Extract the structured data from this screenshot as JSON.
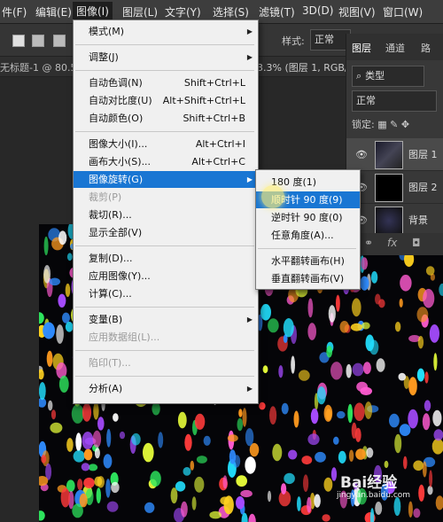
{
  "menubar": {
    "items": [
      "件(F)",
      "编辑(E)",
      "图像(I)",
      "图层(L)",
      "文字(Y)",
      "选择(S)",
      "滤镜(T)",
      "3D(D)",
      "视图(V)",
      "窗口(W)"
    ]
  },
  "options": {
    "style_label": "样式:",
    "style_value": "正常"
  },
  "document_tab": {
    "left": "无标题-1 @ 80.5",
    "right": "3.3% (图层 1, RGB/8"
  },
  "layers_panel": {
    "tabs": [
      "图层",
      "通道",
      "路"
    ],
    "kind_filter": "类型",
    "blend_mode": "正常",
    "lock_label": "锁定:",
    "layers": [
      {
        "name": "图层 1"
      },
      {
        "name": "图层 2"
      },
      {
        "name": "背景"
      }
    ],
    "footer": "fx"
  },
  "image_menu": {
    "items": [
      {
        "label": "模式(M)",
        "shortcut": "",
        "submenu": true
      },
      {
        "sep": true
      },
      {
        "label": "调整(J)",
        "shortcut": "",
        "submenu": true
      },
      {
        "sep": true
      },
      {
        "label": "自动色调(N)",
        "shortcut": "Shift+Ctrl+L"
      },
      {
        "label": "自动对比度(U)",
        "shortcut": "Alt+Shift+Ctrl+L"
      },
      {
        "label": "自动颜色(O)",
        "shortcut": "Shift+Ctrl+B"
      },
      {
        "sep": true
      },
      {
        "label": "图像大小(I)...",
        "shortcut": "Alt+Ctrl+I"
      },
      {
        "label": "画布大小(S)...",
        "shortcut": "Alt+Ctrl+C"
      },
      {
        "label": "图像旋转(G)",
        "shortcut": "",
        "submenu": true,
        "highlighted": true
      },
      {
        "label": "裁剪(P)",
        "shortcut": "",
        "disabled": true
      },
      {
        "label": "裁切(R)...",
        "shortcut": ""
      },
      {
        "label": "显示全部(V)",
        "shortcut": ""
      },
      {
        "sep": true
      },
      {
        "label": "复制(D)...",
        "shortcut": ""
      },
      {
        "label": "应用图像(Y)...",
        "shortcut": ""
      },
      {
        "label": "计算(C)...",
        "shortcut": ""
      },
      {
        "sep": true
      },
      {
        "label": "变量(B)",
        "shortcut": "",
        "submenu": true
      },
      {
        "label": "应用数据组(L)...",
        "shortcut": "",
        "disabled": true
      },
      {
        "sep": true
      },
      {
        "label": "陷印(T)...",
        "shortcut": "",
        "disabled": true
      },
      {
        "sep": true
      },
      {
        "label": "分析(A)",
        "shortcut": "",
        "submenu": true
      }
    ]
  },
  "rotate_submenu": {
    "items": [
      {
        "label": "180 度(1)"
      },
      {
        "label": "顺时针 90 度(9)",
        "highlighted": true
      },
      {
        "label": "逆时针 90 度(0)"
      },
      {
        "label": "任意角度(A)..."
      },
      {
        "sep": true
      },
      {
        "label": "水平翻转画布(H)"
      },
      {
        "label": "垂直翻转画布(V)"
      }
    ]
  },
  "watermark": {
    "brand": "Bai经验",
    "url": "jingyan.baidu.com"
  },
  "colors": {
    "menu_highlight": "#1976d3",
    "menu_bg": "#f0f0f0",
    "ui_dark": "#3d3d3d"
  }
}
